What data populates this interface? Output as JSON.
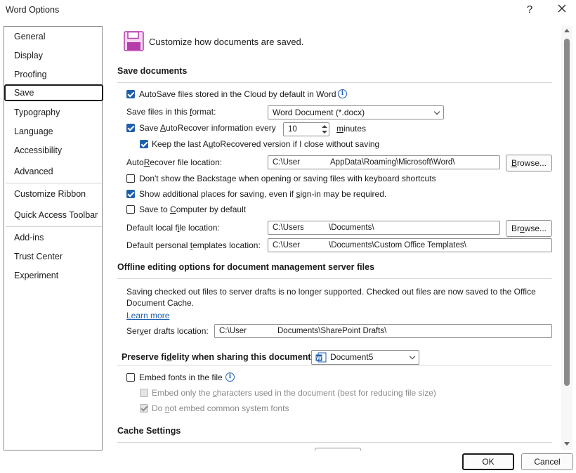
{
  "window": {
    "title": "Word Options",
    "help": "?",
    "close": "✕"
  },
  "sidebar": {
    "items": [
      {
        "label": "General"
      },
      {
        "label": "Display"
      },
      {
        "label": "Proofing"
      },
      {
        "label": "Save"
      },
      {
        "label": "Typography"
      },
      {
        "label": "Language"
      },
      {
        "label": "Accessibility"
      },
      {
        "label": "Advanced"
      },
      {
        "label": "Customize Ribbon"
      },
      {
        "label": "Quick Access Toolbar"
      },
      {
        "label": "Add-ins"
      },
      {
        "label": "Trust Center"
      },
      {
        "label": "Experiment"
      }
    ],
    "selected": "Save"
  },
  "header": {
    "text": "Customize how documents are saved."
  },
  "save_documents": {
    "title": "Save documents",
    "autosave": {
      "label": "AutoSave files stored in the Cloud by default in Word",
      "checked": true
    },
    "format": {
      "label": "Save files in this format:",
      "value": "Word Document (*.docx)"
    },
    "autorecover": {
      "label": "Save AutoRecover information every",
      "value": "10",
      "unit": "minutes",
      "checked": true
    },
    "keep_last": {
      "label": "Keep the last AutoRecovered version if I close without saving",
      "checked": true
    },
    "ar_location": {
      "label": "AutoRecover file location:",
      "value_start": "C:\\User",
      "value_end": "AppData\\Roaming\\Microsoft\\Word\\",
      "browse": "Browse..."
    },
    "backstage": {
      "label": "Don't show the Backstage when opening or saving files with keyboard shortcuts",
      "checked": false
    },
    "additional": {
      "label": "Show additional places for saving, even if sign-in may be required.",
      "checked": true
    },
    "save_computer": {
      "label": "Save to Computer by default",
      "checked": false
    },
    "local_location": {
      "label": "Default local file location:",
      "value_start": "C:\\Users",
      "value_end": "\\Documents\\",
      "browse": "Browse..."
    },
    "templates_location": {
      "label": "Default personal templates location:",
      "value_start": "C:\\User",
      "value_end": "\\Documents\\Custom Office Templates\\"
    }
  },
  "offline": {
    "title": "Offline editing options for document management server files",
    "message": "Saving checked out files to server drafts is no longer supported. Checked out files are now saved to the Office Document Cache.",
    "learn_more": "Learn more",
    "drafts": {
      "label": "Server drafts location:",
      "value_start": "C:\\User",
      "value_end": "Documents\\SharePoint Drafts\\"
    }
  },
  "fidelity": {
    "title": "Preserve fidelity when sharing this document:",
    "document": "Document5",
    "embed_fonts": {
      "label": "Embed fonts in the file",
      "checked": false
    },
    "embed_only": {
      "label": "Embed only the characters used in the document (best for reducing file size)",
      "checked": false,
      "disabled": true
    },
    "no_common": {
      "label": "Do not embed common system fonts",
      "checked": true,
      "disabled": true
    }
  },
  "cache": {
    "title": "Cache Settings"
  },
  "footer": {
    "ok": "OK",
    "cancel": "Cancel"
  },
  "colors": {
    "accent": "#1e5fae",
    "save_icon": "#b43dab"
  }
}
